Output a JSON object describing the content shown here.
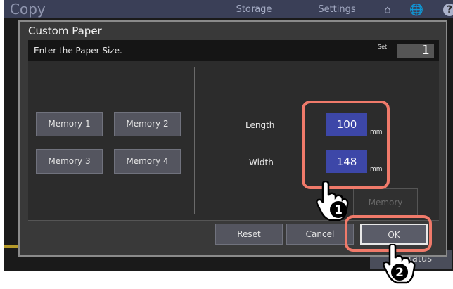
{
  "app": {
    "title": "Copy"
  },
  "top_tabs": [
    {
      "label": "Storage"
    },
    {
      "label": "Settings"
    }
  ],
  "background": {
    "status_label": "Status"
  },
  "dialog": {
    "title": "Custom Paper",
    "instruction": "Enter the Paper Size.",
    "set_label": "Set",
    "set_value": "1",
    "memory_buttons": [
      {
        "label": "Memory 1"
      },
      {
        "label": "Memory 2"
      },
      {
        "label": "Memory 3"
      },
      {
        "label": "Memory 4"
      }
    ],
    "length": {
      "label": "Length",
      "value": "100",
      "unit": "mm"
    },
    "width": {
      "label": "Width",
      "value": "148",
      "unit": "mm"
    },
    "memory_save_label": "Memory",
    "reset_label": "Reset",
    "cancel_label": "Cancel",
    "ok_label": "OK"
  },
  "callouts": [
    {
      "number": "1"
    },
    {
      "number": "2"
    }
  ],
  "colors": {
    "highlight": "#f07a6a",
    "field_blue": "#3d47a8"
  }
}
